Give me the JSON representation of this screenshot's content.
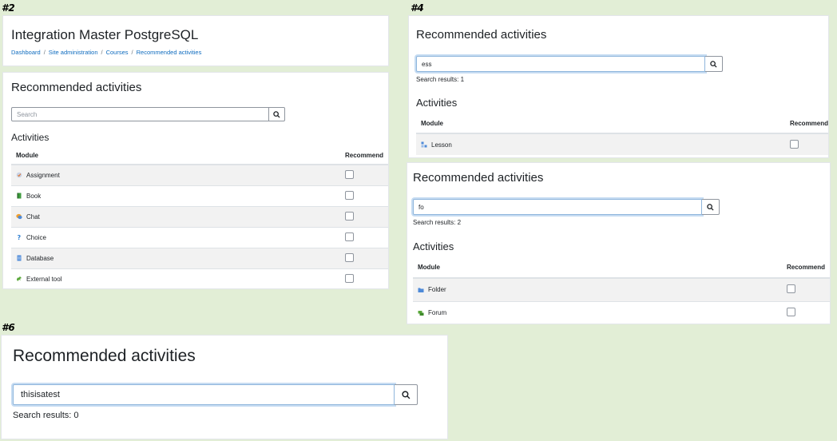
{
  "labels": {
    "p2": "#2",
    "p4": "#4",
    "p6": "#6"
  },
  "panel2": {
    "site_title": "Integration Master PostgreSQL",
    "breadcrumbs": [
      "Dashboard",
      "Site administration",
      "Courses",
      "Recommended activities"
    ],
    "page_title": "Recommended activities",
    "search": {
      "placeholder": "Search",
      "value": ""
    },
    "section_title": "Activities",
    "table": {
      "col_module": "Module",
      "col_recommend": "Recommend",
      "rows": [
        {
          "name": "Assignment",
          "icon": "assignment-icon",
          "recommended": false
        },
        {
          "name": "Book",
          "icon": "book-icon",
          "recommended": false
        },
        {
          "name": "Chat",
          "icon": "chat-icon",
          "recommended": false
        },
        {
          "name": "Choice",
          "icon": "choice-icon",
          "recommended": false
        },
        {
          "name": "Database",
          "icon": "database-icon",
          "recommended": false
        },
        {
          "name": "External tool",
          "icon": "external-tool-icon",
          "recommended": false
        }
      ]
    }
  },
  "panel4a": {
    "page_title": "Recommended activities",
    "search": {
      "value": "ess"
    },
    "results": "Search results: 1",
    "section_title": "Activities",
    "table": {
      "col_module": "Module",
      "col_recommend": "Recommend",
      "rows": [
        {
          "name": "Lesson",
          "icon": "lesson-icon",
          "recommended": false
        }
      ]
    }
  },
  "panel4b": {
    "page_title": "Recommended activities",
    "search": {
      "value": "fo"
    },
    "results": "Search results: 2",
    "section_title": "Activities",
    "table": {
      "col_module": "Module",
      "col_recommend": "Recommend",
      "rows": [
        {
          "name": "Folder",
          "icon": "folder-icon",
          "recommended": false
        },
        {
          "name": "Forum",
          "icon": "forum-icon",
          "recommended": false
        }
      ]
    }
  },
  "panel6": {
    "page_title": "Recommended activities",
    "search": {
      "value": "thisisatest"
    },
    "results": "Search results: 0"
  },
  "colors": {
    "background": "#e2eed6",
    "link": "#0f6cbf",
    "focus_border": "#8fb6dc",
    "row_stripe": "#f2f2f2"
  }
}
